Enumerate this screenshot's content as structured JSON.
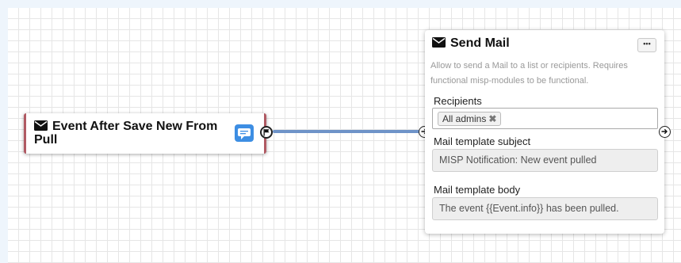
{
  "trigger_node": {
    "title": "Event After Save New From Pull",
    "icon": "envelope-icon",
    "badge_icon": "comments-icon",
    "border_color": "#b05a63",
    "badge_color": "#3d8ee3"
  },
  "connection": {
    "color": "#6e93c8"
  },
  "action_node": {
    "title": "Send Mail",
    "icon": "envelope-icon",
    "menu_label": "•••",
    "description": "Allow to send a Mail to a list or recipients. Requires functional misp-modules to be functional.",
    "fields": {
      "recipients": {
        "label": "Recipients",
        "chips": [
          "All admins"
        ]
      },
      "subject": {
        "label": "Mail template subject",
        "value": "MISP Notification: New event pulled"
      },
      "body": {
        "label": "Mail template body",
        "value": "The event {{Event.info}} has been pulled."
      }
    }
  }
}
